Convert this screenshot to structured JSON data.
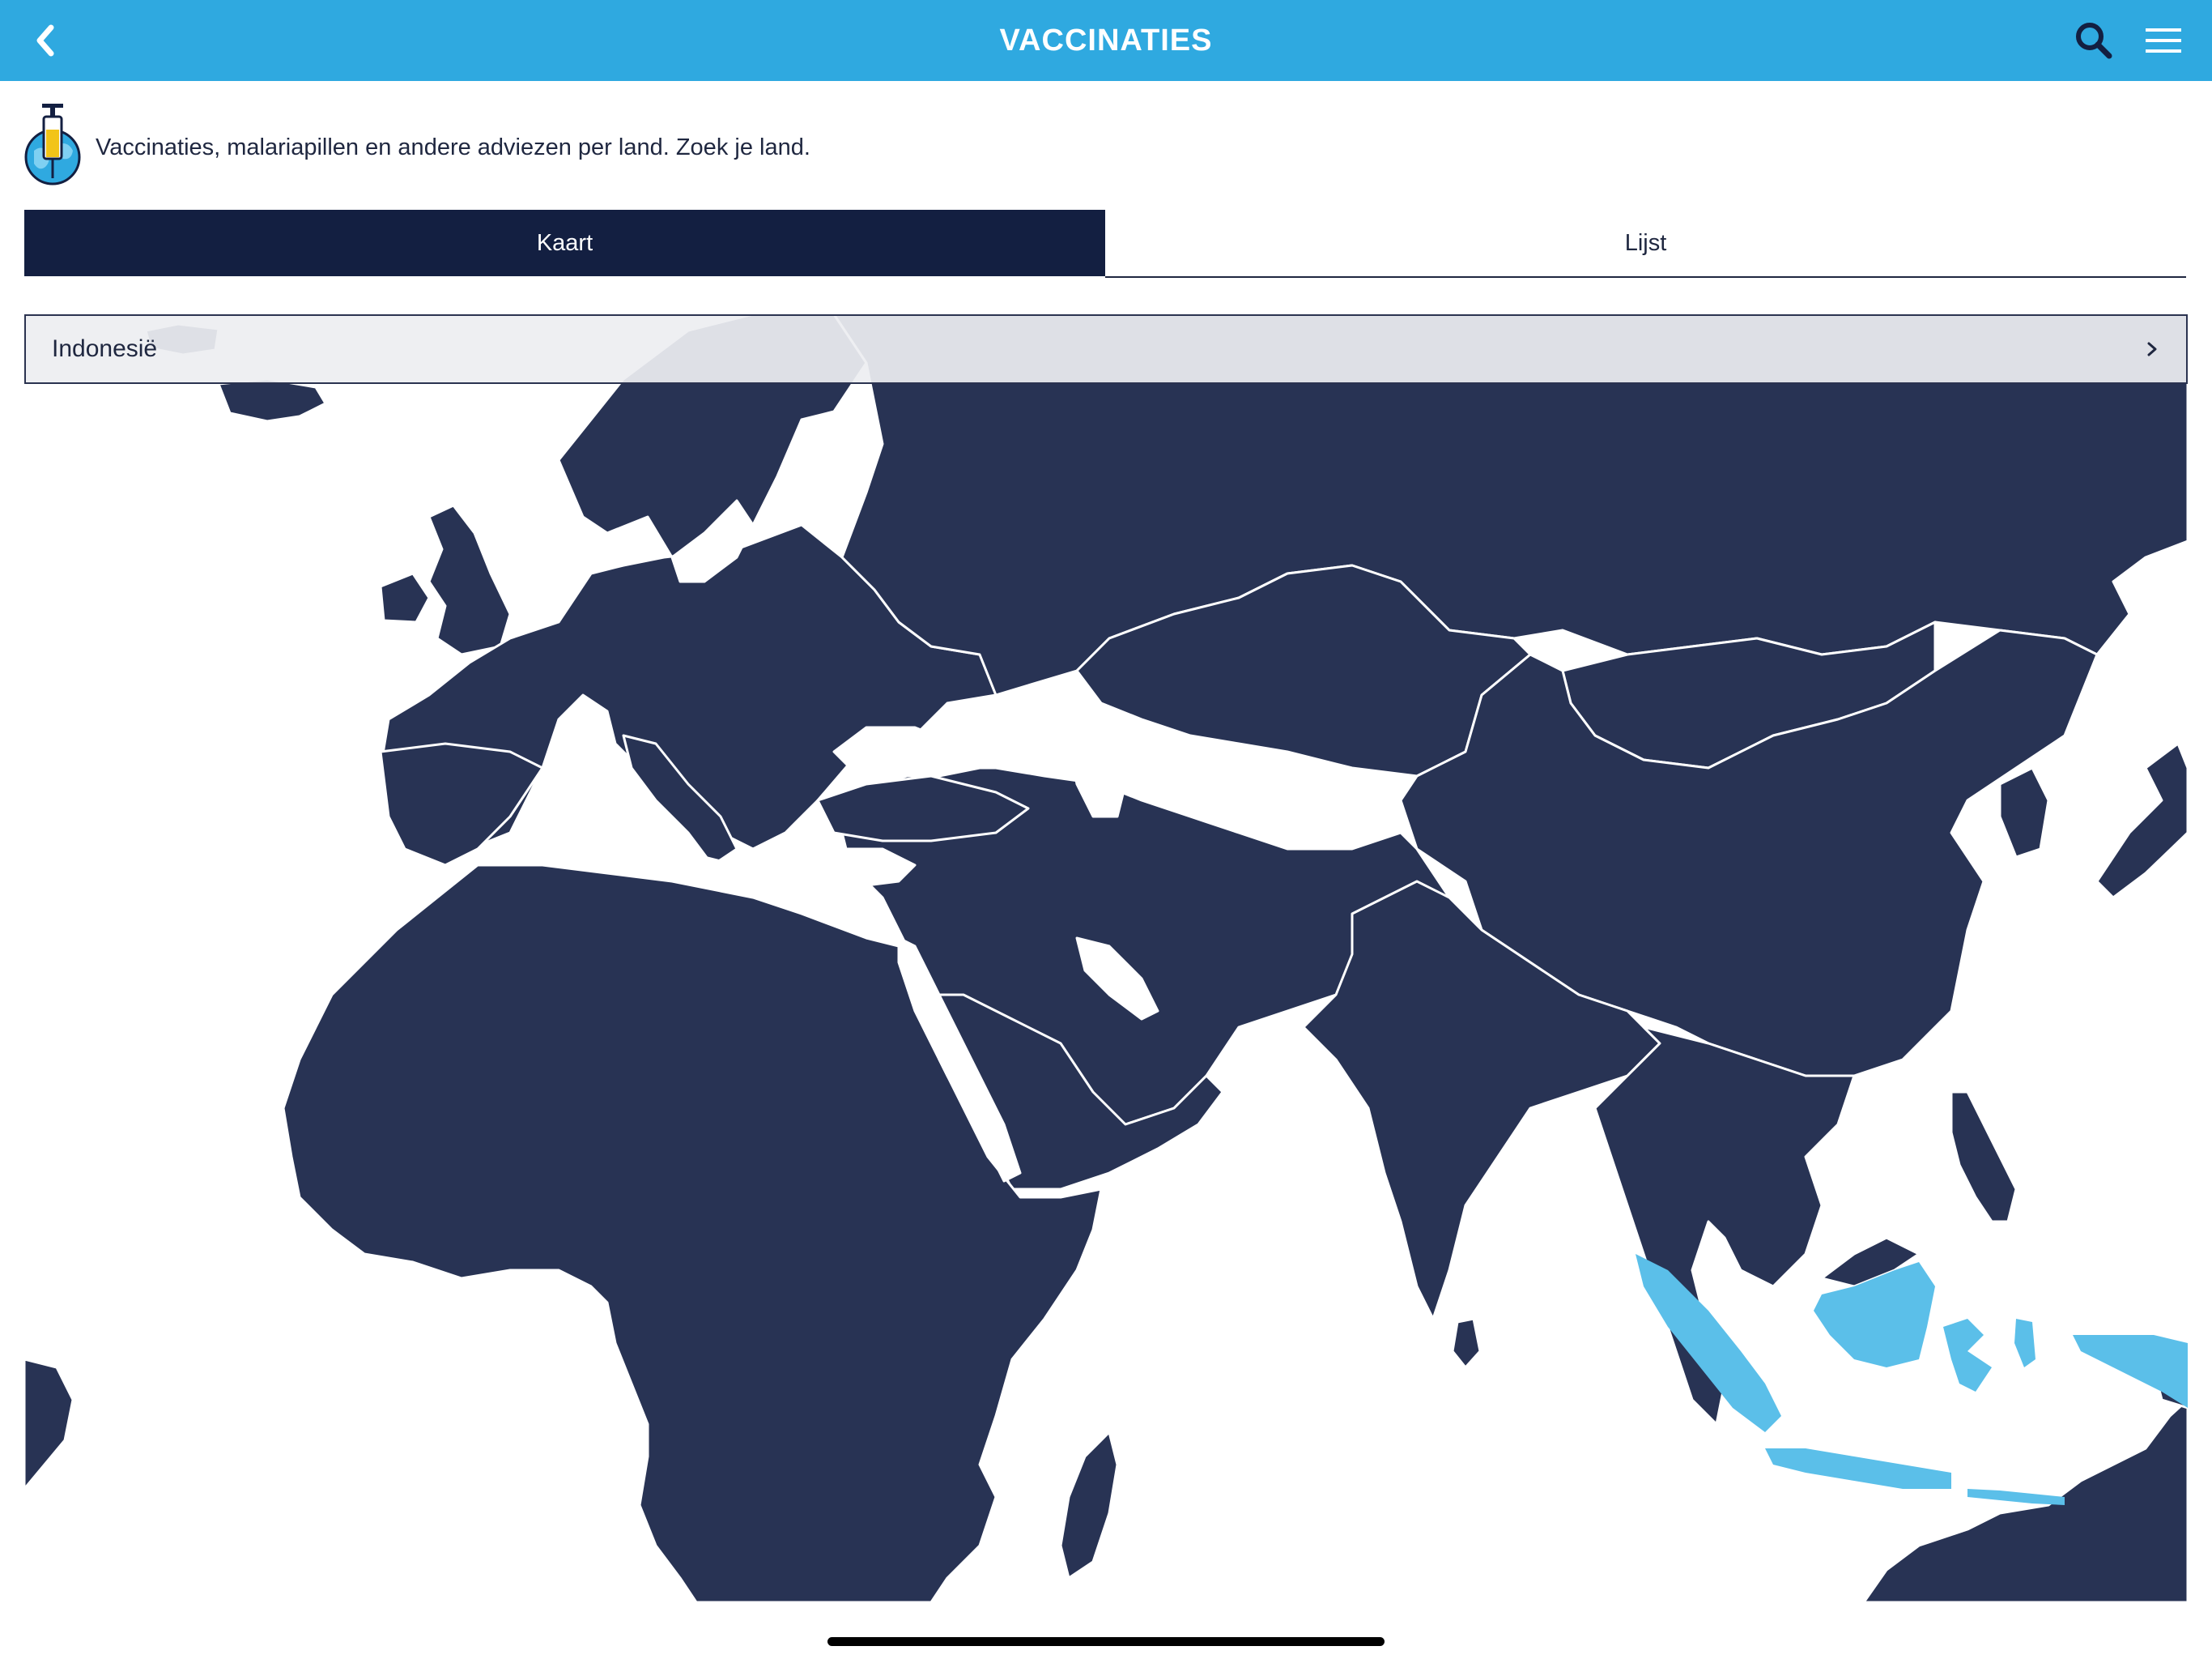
{
  "header": {
    "title": "VACCINATIES"
  },
  "intro": {
    "text": "Vaccinaties, malariapillen en andere adviezen per land. Zoek je land."
  },
  "tabs": [
    {
      "label": "Kaart",
      "active": true
    },
    {
      "label": "Lijst",
      "active": false
    }
  ],
  "country_select": {
    "value": "Indonesië"
  },
  "map": {
    "highlighted_country": "Indonesië",
    "land_color": "#283354",
    "highlight_color": "#5bbfe9",
    "border_color": "#ffffff"
  },
  "colors": {
    "header": "#2fa9e0",
    "active_tab": "#131f41"
  },
  "icons": {
    "back": "chevron-left-icon",
    "search": "search-icon",
    "menu": "hamburger-menu-icon",
    "logo": "vaccine-syringe-globe-icon",
    "select": "chevron-right-icon"
  }
}
